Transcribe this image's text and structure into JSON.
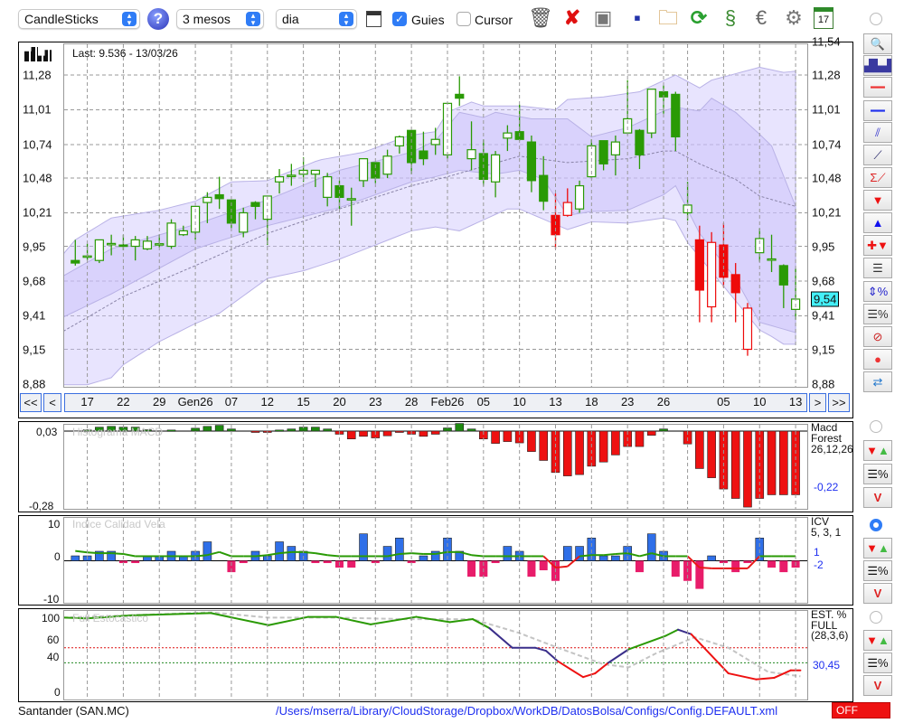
{
  "toolbar": {
    "chart_type": "CandleSticks",
    "period": "3 mesos",
    "interval": "dia",
    "guides_label": "Guies",
    "guides_checked": true,
    "cursor_label": "Cursor",
    "cursor_checked": false,
    "icons": [
      "trash-icon",
      "delete-icon",
      "screenshot-icon",
      "save-icon",
      "folder-icon",
      "refresh-icon",
      "update-icon",
      "euro-icon",
      "gear-icon",
      "calendar-icon"
    ],
    "calendar_day": "17"
  },
  "main": {
    "last_label": "Last: 9.536 - 13/03/26",
    "current_price": "9,54",
    "left_ticks": [
      "11,28",
      "11,01",
      "10,74",
      "10,48",
      "10,21",
      "9,95",
      "9,68",
      "9,41",
      "9,15",
      "8,88"
    ],
    "right_ticks": [
      "11,54",
      "11,28",
      "11,01",
      "10,74",
      "10,48",
      "10,21",
      "9,95",
      "9,68",
      "9,41",
      "9,15",
      "8,88"
    ],
    "nav": {
      "first": "<<",
      "prev": "<",
      "next": ">",
      "last": ">>"
    }
  },
  "side_buttons": [
    "zoom-icon",
    "chart-preview-icon",
    "red-line-icon",
    "blue-line-icon",
    "channel-icon",
    "trendline-icon",
    "sum-trendline-icon",
    "sell-arrow-icon",
    "buy-arrow-icon",
    "add-signal-icon",
    "grid-lines-icon",
    "range-percent-icon",
    "levels-percent-icon",
    "forbidden-icon",
    "record-icon",
    "swap-icon"
  ],
  "macd": {
    "title": "Histograma MACD",
    "top_tick": "0,03",
    "bottom_tick": "-0,28",
    "name": "Macd",
    "sub": "Forest",
    "params": "26,12,26",
    "value": "-0,22"
  },
  "icv": {
    "title": "Indice Calidad Vela",
    "ticks": [
      "10",
      "0",
      "-10"
    ],
    "name": "ICV",
    "params": "5, 3, 1",
    "value1": "1",
    "value2": "-2"
  },
  "stoch": {
    "title": "Full Estocastico",
    "ticks": [
      "100",
      "60",
      "40",
      "0"
    ],
    "name": "EST. %",
    "sub": "FULL",
    "params": "(28,3,6)",
    "value": "30,45"
  },
  "footer": {
    "symbol": "Santander (SAN.MC)",
    "path": "/Users/mserra/Library/CloudStorage/Dropbox/WorkDB/DatosBolsa/Configs/Config.DEFAULT.xml",
    "status": "OFF"
  },
  "colors": {
    "up": "#2a9a05",
    "down_red": "#ee0a0a",
    "band": "#cfc6fb",
    "macd_pos": "#1e8a10",
    "macd_neg": "#ee1111",
    "icv_pos": "#2f6fe8",
    "icv_neg": "#e81c6a",
    "cursor": "#44f0f8"
  },
  "chart_data": {
    "type": "candlestick",
    "price_range": [
      8.88,
      11.54
    ],
    "x_labels": [
      [
        2,
        "17"
      ],
      [
        5,
        "22"
      ],
      [
        8,
        "29"
      ],
      [
        11,
        "Gen26"
      ],
      [
        14,
        "07"
      ],
      [
        17,
        "12"
      ],
      [
        20,
        "15"
      ],
      [
        23,
        "20"
      ],
      [
        26,
        "23"
      ],
      [
        29,
        "28"
      ],
      [
        32,
        "Feb26"
      ],
      [
        35,
        "05"
      ],
      [
        38,
        "10"
      ],
      [
        41,
        "13"
      ],
      [
        44,
        "18"
      ],
      [
        47,
        "23"
      ],
      [
        50,
        "26"
      ],
      [
        55,
        "05"
      ],
      [
        58,
        "10"
      ],
      [
        61,
        "13"
      ]
    ],
    "grid_indices": [
      2,
      5,
      8,
      11,
      14,
      17,
      20,
      23,
      26,
      29,
      32,
      35,
      38,
      41,
      44,
      47,
      50,
      52,
      55,
      58,
      61
    ],
    "candles": [
      [
        9.84,
        10.0,
        9.8,
        9.82,
        "g"
      ],
      [
        9.87,
        9.97,
        9.84,
        9.875,
        "g"
      ],
      [
        9.84,
        10.0,
        9.82,
        10.0,
        "g"
      ],
      [
        9.97,
        10.04,
        9.88,
        9.972,
        "g"
      ],
      [
        9.96,
        10.04,
        9.92,
        9.95,
        "g"
      ],
      [
        9.95,
        10.03,
        9.84,
        10.0,
        "g"
      ],
      [
        9.93,
        10.03,
        9.92,
        9.99,
        "g"
      ],
      [
        9.965,
        10.04,
        9.94,
        9.97,
        "g"
      ],
      [
        9.95,
        10.16,
        9.93,
        10.13,
        "g"
      ],
      [
        10.04,
        10.11,
        10.03,
        10.07,
        "g"
      ],
      [
        10.06,
        10.26,
        10.0,
        10.26,
        "g"
      ],
      [
        10.29,
        10.37,
        10.13,
        10.33,
        "g"
      ],
      [
        10.35,
        10.49,
        10.24,
        10.32,
        "g"
      ],
      [
        10.31,
        10.31,
        10.09,
        10.13,
        "g"
      ],
      [
        10.06,
        10.25,
        10.02,
        10.21,
        "g"
      ],
      [
        10.29,
        10.3,
        10.16,
        10.26,
        "g"
      ],
      [
        10.16,
        10.34,
        9.96,
        10.34,
        "g"
      ],
      [
        10.45,
        10.55,
        10.36,
        10.49,
        "g"
      ],
      [
        10.5,
        10.59,
        10.42,
        10.502,
        "g"
      ],
      [
        10.51,
        10.64,
        10.45,
        10.54,
        "g"
      ],
      [
        10.51,
        10.54,
        10.41,
        10.54,
        "g"
      ],
      [
        10.33,
        10.52,
        10.26,
        10.49,
        "g"
      ],
      [
        10.42,
        10.46,
        10.24,
        10.33,
        "g"
      ],
      [
        10.31,
        10.405,
        10.11,
        10.32,
        "g"
      ],
      [
        10.46,
        10.63,
        10.41,
        10.63,
        "g"
      ],
      [
        10.6,
        10.6,
        10.44,
        10.48,
        "g"
      ],
      [
        10.51,
        10.7,
        10.48,
        10.65,
        "g"
      ],
      [
        10.73,
        10.81,
        10.67,
        10.8,
        "g"
      ],
      [
        10.85,
        10.85,
        10.51,
        10.6,
        "g"
      ],
      [
        10.69,
        10.84,
        10.58,
        10.63,
        "g"
      ],
      [
        10.74,
        10.87,
        10.66,
        10.78,
        "g"
      ],
      [
        10.66,
        11.06,
        10.63,
        11.06,
        "g"
      ],
      [
        11.13,
        11.27,
        11.04,
        11.1,
        "g"
      ],
      [
        10.63,
        10.92,
        10.54,
        10.7,
        "g"
      ],
      [
        10.67,
        10.78,
        10.42,
        10.47,
        "g"
      ],
      [
        10.45,
        10.69,
        10.33,
        10.66,
        "g"
      ],
      [
        10.79,
        10.89,
        10.69,
        10.83,
        "g"
      ],
      [
        10.84,
        11.05,
        10.77,
        10.78,
        "g"
      ],
      [
        10.76,
        10.81,
        10.37,
        10.46,
        "g"
      ],
      [
        10.5,
        10.65,
        10.23,
        10.3,
        "g"
      ],
      [
        10.19,
        10.36,
        9.93,
        10.04,
        "r"
      ],
      [
        10.19,
        10.4,
        10.18,
        10.29,
        "r"
      ],
      [
        10.24,
        10.46,
        10.21,
        10.42,
        "g"
      ],
      [
        10.49,
        10.78,
        10.48,
        10.73,
        "g"
      ],
      [
        10.77,
        10.77,
        10.54,
        10.59,
        "g"
      ],
      [
        10.66,
        10.81,
        10.5,
        10.76,
        "g"
      ],
      [
        10.83,
        11.24,
        10.82,
        10.94,
        "g"
      ],
      [
        10.85,
        10.86,
        10.55,
        10.66,
        "g"
      ],
      [
        10.83,
        11.17,
        10.79,
        11.17,
        "g"
      ],
      [
        11.15,
        11.2,
        10.98,
        11.11,
        "g"
      ],
      [
        11.13,
        11.15,
        10.69,
        10.8,
        "g"
      ],
      [
        10.21,
        10.45,
        10.15,
        10.27,
        "g"
      ],
      [
        10.0,
        10.11,
        9.36,
        9.61,
        "r"
      ],
      [
        9.48,
        10.06,
        9.36,
        9.98,
        "r"
      ],
      [
        9.96,
        10.13,
        9.63,
        9.71,
        "r"
      ],
      [
        9.73,
        9.82,
        9.36,
        9.59,
        "r"
      ],
      [
        9.15,
        9.51,
        9.1,
        9.47,
        "r"
      ],
      [
        9.9,
        10.09,
        9.83,
        10.01,
        "g"
      ],
      [
        9.85,
        10.04,
        9.75,
        9.852,
        "g"
      ],
      [
        9.8,
        9.81,
        9.47,
        9.65,
        "g"
      ],
      [
        9.46,
        9.78,
        9.38,
        9.54,
        "g"
      ]
    ],
    "bands": {
      "outer_upper": [
        [
          0,
          9.89
        ],
        [
          1,
          10.0
        ],
        [
          4,
          10.17
        ],
        [
          8,
          10.23
        ],
        [
          11,
          10.3
        ],
        [
          14,
          10.45
        ],
        [
          17,
          10.46
        ],
        [
          21.3,
          10.62
        ],
        [
          25,
          10.68
        ],
        [
          28.8,
          10.81
        ],
        [
          31,
          10.84
        ],
        [
          32,
          10.99
        ],
        [
          34,
          11.07
        ],
        [
          35,
          11.04
        ],
        [
          38,
          11.04
        ],
        [
          41,
          11.01
        ],
        [
          42,
          11.09
        ],
        [
          45,
          11.11
        ],
        [
          48,
          11.15
        ],
        [
          51,
          11.28
        ],
        [
          53,
          11.18
        ],
        [
          54,
          11.24
        ],
        [
          56,
          11.29
        ],
        [
          58,
          11.34
        ],
        [
          60,
          11.3
        ],
        [
          61,
          11.31
        ]
      ],
      "outer_lower": [
        [
          0,
          8.875
        ],
        [
          2,
          8.875
        ],
        [
          4,
          8.93
        ],
        [
          5,
          9.03
        ],
        [
          8,
          9.21
        ],
        [
          11,
          9.35
        ],
        [
          13,
          9.43
        ],
        [
          17,
          9.7
        ],
        [
          20,
          9.76
        ],
        [
          23,
          9.85
        ],
        [
          26,
          9.96
        ],
        [
          29,
          10.07
        ],
        [
          31,
          10.1
        ],
        [
          33,
          10.07
        ],
        [
          37,
          10.24
        ],
        [
          38,
          10.24
        ],
        [
          41,
          10.12
        ],
        [
          42,
          10.08
        ],
        [
          44,
          10.14
        ],
        [
          47,
          10.13
        ],
        [
          50,
          10.17
        ],
        [
          51,
          10.15
        ],
        [
          52,
          9.98
        ],
        [
          58,
          9.3
        ],
        [
          59,
          9.25
        ],
        [
          60,
          9.19
        ],
        [
          61,
          9.19
        ]
      ],
      "inner_upper": [
        [
          0,
          9.72
        ],
        [
          4,
          9.93
        ],
        [
          11,
          10.12
        ],
        [
          17,
          10.31
        ],
        [
          23,
          10.54
        ],
        [
          29,
          10.68
        ],
        [
          31,
          10.77
        ],
        [
          33,
          10.99
        ],
        [
          35,
          10.95
        ],
        [
          36,
          10.99
        ],
        [
          39,
          10.94
        ],
        [
          42,
          10.94
        ],
        [
          44,
          10.8
        ],
        [
          47,
          10.87
        ],
        [
          50,
          11.0
        ],
        [
          51,
          11.03
        ],
        [
          53,
          11.0
        ],
        [
          54,
          11.1
        ],
        [
          56,
          10.99
        ],
        [
          58,
          10.82
        ],
        [
          59,
          10.73
        ],
        [
          61,
          10.26
        ]
      ],
      "inner_lower": [
        [
          0,
          9.4
        ],
        [
          4,
          9.58
        ],
        [
          11,
          9.93
        ],
        [
          17,
          10.11
        ],
        [
          23,
          10.25
        ],
        [
          29,
          10.45
        ],
        [
          31,
          10.49
        ],
        [
          33,
          10.54
        ],
        [
          36,
          10.51
        ],
        [
          38,
          10.54
        ],
        [
          40,
          10.47
        ],
        [
          42,
          10.19
        ],
        [
          44,
          10.22
        ],
        [
          47,
          10.23
        ],
        [
          50,
          10.35
        ],
        [
          51,
          10.42
        ],
        [
          53,
          10.05
        ],
        [
          56,
          9.7
        ],
        [
          58,
          9.36
        ],
        [
          61,
          9.28
        ]
      ],
      "middle": [
        [
          0,
          9.29
        ],
        [
          5,
          9.56
        ],
        [
          11,
          9.8
        ],
        [
          17,
          10.05
        ],
        [
          23,
          10.24
        ],
        [
          29,
          10.42
        ],
        [
          32,
          10.49
        ],
        [
          38,
          10.65
        ],
        [
          42,
          10.6
        ],
        [
          47,
          10.63
        ],
        [
          50,
          10.69
        ],
        [
          51,
          10.69
        ],
        [
          53,
          10.59
        ],
        [
          56,
          10.47
        ],
        [
          58,
          10.34
        ],
        [
          61,
          10.26
        ]
      ]
    },
    "macd_hist": [
      0,
      0.005,
      0.015,
      0.018,
      0.015,
      0.015,
      0.005,
      0,
      0.004,
      0,
      0.011,
      0.018,
      0.022,
      0.008,
      0,
      -0.004,
      -0.004,
      0.004,
      0.008,
      0.015,
      0.015,
      0.008,
      -0.012,
      -0.03,
      -0.02,
      -0.026,
      -0.018,
      -0.004,
      -0.012,
      -0.02,
      -0.012,
      0.012,
      0.029,
      0.008,
      -0.03,
      -0.047,
      -0.04,
      -0.045,
      -0.078,
      -0.112,
      -0.158,
      -0.171,
      -0.166,
      -0.134,
      -0.118,
      -0.091,
      -0.059,
      -0.059,
      -0.016,
      0.008,
      0,
      -0.049,
      -0.143,
      -0.178,
      -0.221,
      -0.257,
      -0.29,
      -0.257,
      -0.243,
      -0.243,
      -0.243
    ],
    "icv_bars": [
      1.3,
      1.3,
      2.5,
      2.5,
      -0.6,
      -0.6,
      1.3,
      1.3,
      2.5,
      1.3,
      2.5,
      5,
      0,
      -3,
      -0.6,
      2.5,
      1.3,
      5,
      3.8,
      2.5,
      -0.6,
      -0.6,
      -1.8,
      -1.8,
      7.1,
      -0.6,
      3.8,
      6,
      -0.6,
      1.3,
      2.5,
      6,
      2.5,
      -4.2,
      -4.2,
      -0.6,
      3.8,
      2.5,
      -4.2,
      -2.5,
      -5.3,
      3.8,
      3.8,
      6,
      1.3,
      1.3,
      3.8,
      -3,
      7.1,
      2.5,
      -4.2,
      -5.3,
      -7.4,
      1.3,
      -0.6,
      -3,
      -0.6,
      6,
      -1.8,
      -3,
      -1.8
    ],
    "icv_line": [
      2.6,
      2.2,
      2.0,
      2.0,
      1.8,
      1.2,
      1.2,
      1.2,
      1.2,
      1.2,
      1.2,
      1.5,
      2.3,
      1.2,
      1.2,
      1.2,
      1.5,
      2.0,
      2.3,
      2.3,
      2.0,
      1.5,
      1.2,
      1.2,
      1.2,
      1.2,
      1.2,
      1.8,
      2.0,
      1.8,
      1.8,
      2.3,
      2.3,
      1.5,
      1.2,
      1.2,
      1.2,
      1.2,
      1.2,
      1.2,
      -1.8,
      -1.5,
      1.2,
      1.5,
      1.5,
      1.8,
      2.0,
      1.2,
      2.0,
      1.2,
      1.2,
      1.2,
      -1.8,
      -2.0,
      -2.0,
      -2.0,
      -2.0,
      1.2,
      1.2,
      1.2,
      1.2
    ],
    "stoch_k": [
      [
        0,
        100
      ],
      [
        1.9,
        99
      ],
      [
        5.7,
        103
      ],
      [
        12.3,
        106
      ],
      [
        17.1,
        90
      ],
      [
        20.4,
        101
      ],
      [
        22.7,
        101
      ],
      [
        25.6,
        91
      ],
      [
        29.4,
        101
      ],
      [
        32.2,
        94
      ],
      [
        34.1,
        98
      ],
      [
        35.5,
        86
      ],
      [
        37.4,
        60
      ],
      [
        39.3,
        60
      ],
      [
        40.2,
        56
      ],
      [
        41.2,
        42
      ],
      [
        43.3,
        21
      ],
      [
        44.3,
        26
      ],
      [
        45.4,
        40
      ],
      [
        47.1,
        58
      ],
      [
        50.2,
        76
      ],
      [
        51.2,
        84
      ],
      [
        52.3,
        78
      ],
      [
        55.4,
        26
      ],
      [
        57.7,
        18
      ],
      [
        59.2,
        20
      ],
      [
        60.6,
        30
      ],
      [
        61.4,
        30
      ]
    ],
    "stoch_k_colors": [
      [
        0,
        "#2a9a05"
      ],
      [
        35.5,
        "#3a2e8a"
      ],
      [
        41.2,
        "#ee1111"
      ],
      [
        45.4,
        "#3a2e8a"
      ],
      [
        47.1,
        "#2a9a05"
      ],
      [
        51.2,
        "#3a2e8a"
      ],
      [
        52.3,
        "#ee1111"
      ]
    ],
    "stoch_d": [
      [
        0,
        100
      ],
      [
        12.3,
        107
      ],
      [
        17.1,
        100
      ],
      [
        22.7,
        100
      ],
      [
        28.4,
        98
      ],
      [
        34.1,
        98
      ],
      [
        37.9,
        80
      ],
      [
        41.2,
        60
      ],
      [
        45.0,
        38
      ],
      [
        47.1,
        34
      ],
      [
        49.3,
        52
      ],
      [
        52.6,
        74
      ],
      [
        55.4,
        60
      ],
      [
        58.7,
        28
      ],
      [
        61.4,
        22
      ]
    ],
    "stoch_levels": [
      60,
      40
    ]
  }
}
